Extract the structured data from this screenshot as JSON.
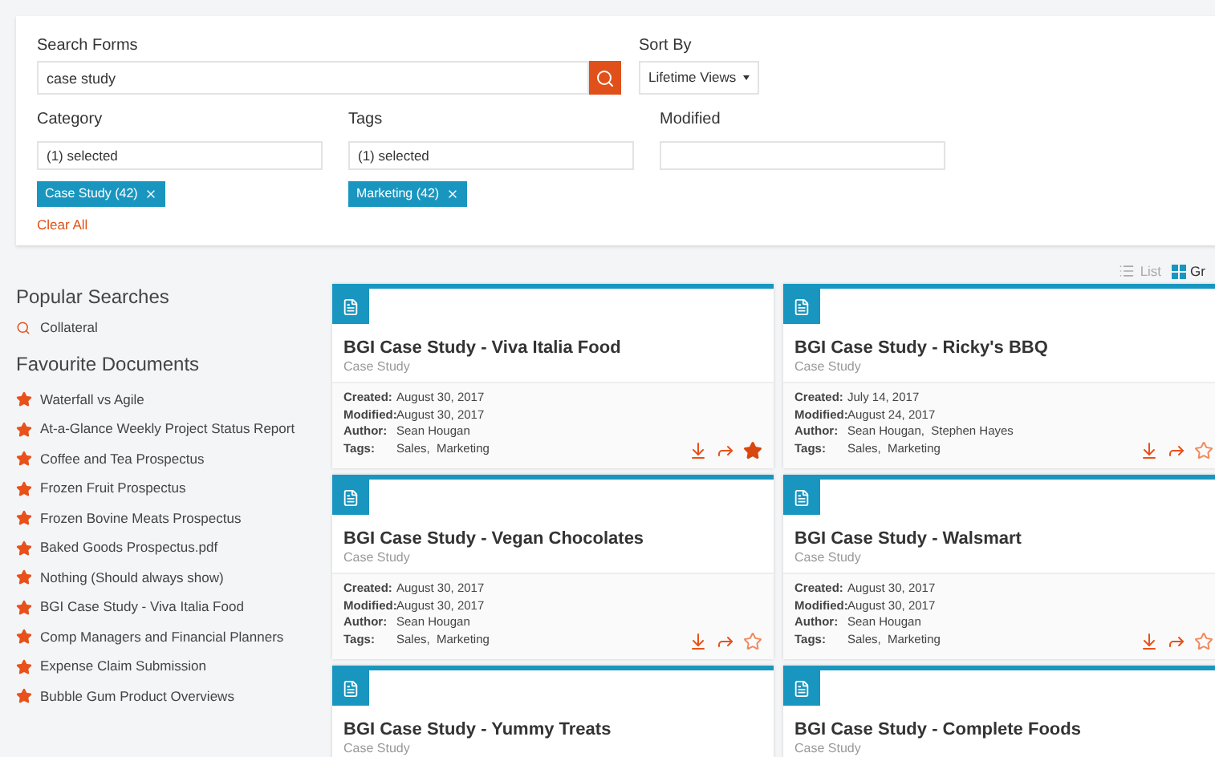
{
  "filters": {
    "search": {
      "label": "Search Forms",
      "value": "case study"
    },
    "sort": {
      "label": "Sort By",
      "value": "Lifetime Views"
    },
    "fields": [
      {
        "label": "Category",
        "value": "(1) selected",
        "chips": [
          "Case Study (42)"
        ]
      },
      {
        "label": "Tags",
        "value": "(1) selected",
        "chips": [
          "Marketing (42)"
        ]
      },
      {
        "label": "Modified"
      }
    ],
    "clear": "Clear All"
  },
  "view_toggle": [
    {
      "label": "List",
      "selected": false,
      "kind": "list"
    },
    {
      "label": "Gr",
      "selected": true,
      "kind": "grid"
    }
  ],
  "sidebar": {
    "popular_title": "Popular Searches",
    "popular": [
      "Collateral"
    ],
    "favourites_title": "Favourite Documents",
    "favourites": [
      "Waterfall vs Agile",
      "At-a-Glance Weekly Project Status Report",
      "Coffee and Tea Prospectus",
      "Frozen Fruit Prospectus",
      "Frozen Bovine Meats Prospectus",
      "Baked Goods Prospectus.pdf",
      "Nothing (Should always show)",
      "BGI Case Study - Viva Italia Food",
      "Comp Managers and Financial Planners",
      "Expense Claim Submission",
      "Bubble Gum Product Overviews"
    ]
  },
  "cards": [
    {
      "title": "BGI Case Study - Viva Italia Food",
      "category": "Case Study",
      "favourite": true,
      "meta": [
        {
          "label": "Created:",
          "value": "August 30, 2017"
        },
        {
          "label": "Modified:",
          "value": "August 30, 2017"
        },
        {
          "label": "Author:",
          "value": "Sean Hougan"
        },
        {
          "label": "Tags:",
          "value": "Sales,  Marketing"
        }
      ]
    },
    {
      "title": "BGI Case Study - Ricky's BBQ",
      "category": "Case Study",
      "favourite": false,
      "meta": [
        {
          "label": "Created:",
          "value": "July 14, 2017"
        },
        {
          "label": "Modified:",
          "value": "August 24, 2017"
        },
        {
          "label": "Author:",
          "value": "Sean Hougan,  Stephen Hayes"
        },
        {
          "label": "Tags:",
          "value": "Sales,  Marketing"
        }
      ]
    },
    {
      "title": "BGI Case Study - Vegan Chocolates",
      "category": "Case Study",
      "favourite": false,
      "meta": [
        {
          "label": "Created:",
          "value": "August 30, 2017"
        },
        {
          "label": "Modified:",
          "value": "August 30, 2017"
        },
        {
          "label": "Author:",
          "value": "Sean Hougan"
        },
        {
          "label": "Tags:",
          "value": "Sales,  Marketing"
        }
      ]
    },
    {
      "title": "BGI Case Study - Walsmart",
      "category": "Case Study",
      "favourite": false,
      "meta": [
        {
          "label": "Created:",
          "value": "August 30, 2017"
        },
        {
          "label": "Modified:",
          "value": "August 30, 2017"
        },
        {
          "label": "Author:",
          "value": "Sean Hougan"
        },
        {
          "label": "Tags:",
          "value": "Sales,  Marketing"
        }
      ]
    },
    {
      "title": "BGI Case Study - Yummy Treats",
      "category": "Case Study"
    },
    {
      "title": "BGI Case Study - Complete Foods",
      "category": "Case Study"
    }
  ]
}
